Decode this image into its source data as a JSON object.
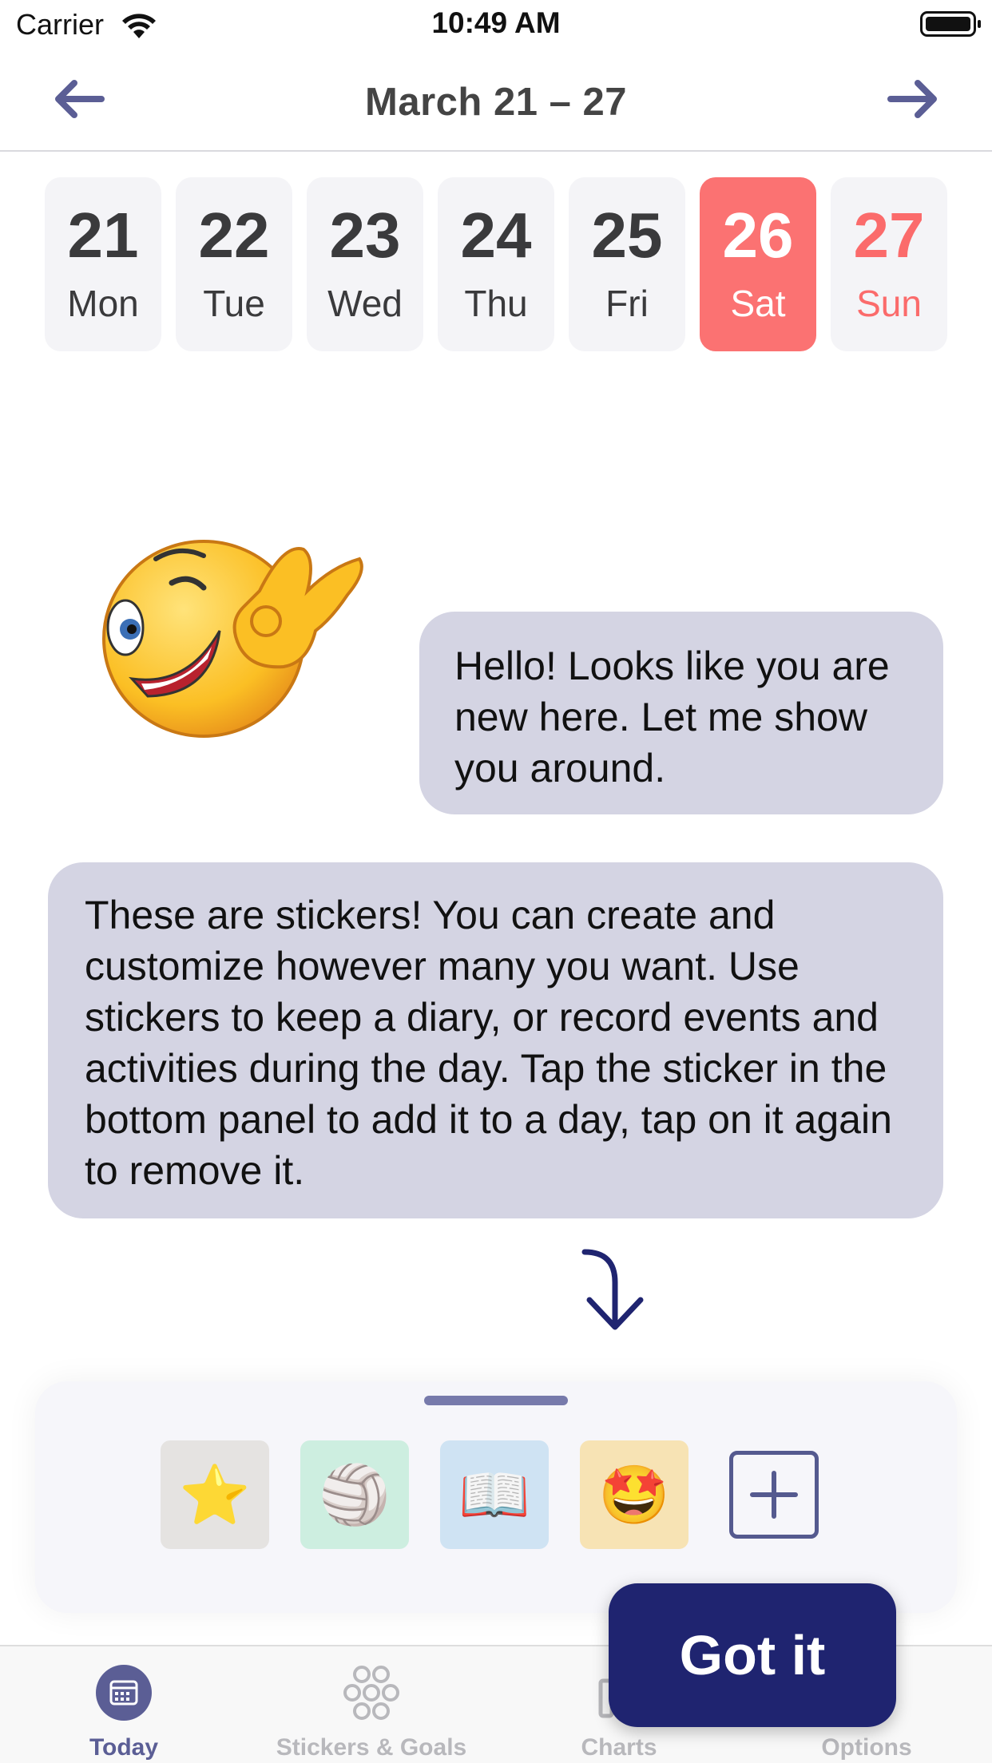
{
  "status_bar": {
    "carrier": "Carrier",
    "time": "10:49 AM"
  },
  "header": {
    "title": "March 21 – 27",
    "prev_icon": "arrow-left-icon",
    "next_icon": "arrow-right-icon",
    "accent_color": "#5b5e95"
  },
  "days": [
    {
      "num": "21",
      "name": "Mon"
    },
    {
      "num": "22",
      "name": "Tue"
    },
    {
      "num": "23",
      "name": "Wed"
    },
    {
      "num": "24",
      "name": "Thu"
    },
    {
      "num": "25",
      "name": "Fri"
    },
    {
      "num": "26",
      "name": "Sat",
      "selected": true
    },
    {
      "num": "27",
      "name": "Sun"
    }
  ],
  "colors": {
    "selected_day": "#fb7272",
    "bubble": "#d4d4e3",
    "button": "#1f2470"
  },
  "tutorial": {
    "mascot_icon": "winking-ok-emoji",
    "greeting": "Hello! Looks like you are new here. Let me show you around.",
    "explanation": "These are stickers! You can create and customize however many you want. Use stickers to keep a diary, or record events and activities during the day. Tap the sticker in the bottom panel to add it to a day, tap on it again to remove it.",
    "pointer_icon": "curved-down-arrow-icon",
    "got_it_label": "Got it"
  },
  "sticker_panel": {
    "stickers": [
      {
        "emoji": "⭐",
        "name": "star-sticker",
        "bg": "#e5e3e1"
      },
      {
        "emoji": "🏐",
        "name": "volleyball-sticker",
        "bg": "#cdeee0"
      },
      {
        "emoji": "📖",
        "name": "book-sticker",
        "bg": "#cfe3f3"
      },
      {
        "emoji": "🤩",
        "name": "star-struck-sticker",
        "bg": "#f7e3b4"
      }
    ],
    "add_icon": "plus-icon"
  },
  "tabs": [
    {
      "label": "Today",
      "icon": "calendar-icon",
      "active": true
    },
    {
      "label": "Stickers & Goals",
      "icon": "stickers-icon"
    },
    {
      "label": "Charts",
      "icon": "chart-icon"
    },
    {
      "label": "Options",
      "icon": "options-icon"
    }
  ]
}
